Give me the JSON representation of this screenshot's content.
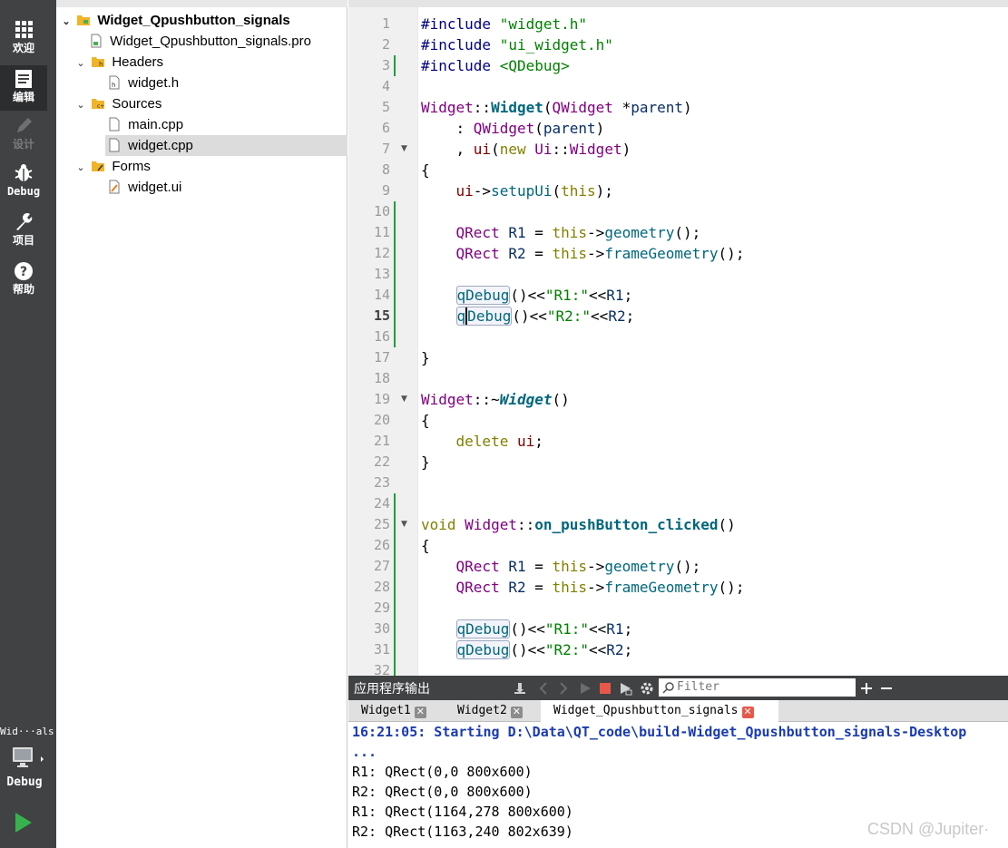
{
  "modebar": {
    "items": [
      {
        "label": "欢迎",
        "icon": "grid-icon"
      },
      {
        "label": "编辑",
        "icon": "document-icon"
      },
      {
        "label": "设计",
        "icon": "pencil-icon"
      },
      {
        "label": "Debug",
        "icon": "bug-icon"
      },
      {
        "label": "项目",
        "icon": "wrench-icon"
      },
      {
        "label": "帮助",
        "icon": "help-icon"
      }
    ],
    "active": "编辑",
    "target_name": "Wid···als",
    "target_mode": "Debug",
    "colors": {
      "background": "#404244",
      "active": "#2b2d2f",
      "run": "#37b24d"
    }
  },
  "tree": {
    "project": "Widget_Qpushbutton_signals",
    "pro_file": "Widget_Qpushbutton_signals.pro",
    "headers_label": "Headers",
    "header_file": "widget.h",
    "sources_label": "Sources",
    "source_files": [
      "main.cpp",
      "widget.cpp"
    ],
    "forms_label": "Forms",
    "form_file": "widget.ui",
    "selected": "widget.cpp"
  },
  "editor": {
    "current_line": 15,
    "lines": [
      "1",
      "2",
      "3",
      "4",
      "5",
      "6",
      "7",
      "8",
      "9",
      "10",
      "11",
      "12",
      "13",
      "14",
      "15",
      "16",
      "17",
      "18",
      "19",
      "20",
      "21",
      "22",
      "23",
      "24",
      "25",
      "26",
      "27",
      "28",
      "29",
      "30",
      "31",
      "32"
    ]
  },
  "output": {
    "title": "应用程序输出",
    "filter_placeholder": "Filter",
    "tabs": [
      "Widget1",
      "Widget2",
      "Widget_Qpushbutton_signals"
    ],
    "active_tab": "Widget_Qpushbutton_signals",
    "lines": [
      "16:21:05: Starting D:\\Data\\QT_code\\build-Widget_Qpushbutton_signals-Desktop",
      "...",
      "R1: QRect(0,0 800x600)",
      "R2: QRect(0,0 800x600)",
      "R1: QRect(1164,278 800x600)",
      "R2: QRect(1163,240 802x639)"
    ]
  },
  "watermark": "CSDN @Jupiter·"
}
